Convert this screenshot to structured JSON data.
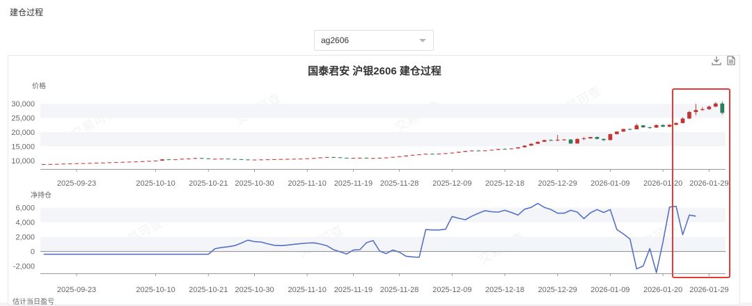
{
  "section_title": "建仓过程",
  "contract_select": {
    "value": "ag2606"
  },
  "chart_title": "国泰君安 沪银2606 建仓过程",
  "toolbar": {
    "download_icon": "download-icon",
    "data_view_icon": "data-view-icon"
  },
  "watermark_text": "交易可查",
  "colors": {
    "up": "#c23531",
    "down": "#2f7e5e",
    "line": "#5470c6",
    "highlight": "#e53935",
    "band": "#f3f5f9"
  },
  "chart_data": [
    {
      "type": "candlestick",
      "ylabel": "价格",
      "y_ticks": [
        "30,000",
        "25,000",
        "20,000",
        "15,000",
        "10,000"
      ],
      "y_tick_values": [
        30000,
        25000,
        20000,
        15000,
        10000
      ],
      "ylim": [
        7000,
        33000
      ],
      "x_tick_labels": [
        "2025-09-23",
        "2025-10-10",
        "2025-10-21",
        "2025-10-30",
        "2025-11-10",
        "2025-11-19",
        "2025-11-28",
        "2025-12-09",
        "2025-12-18",
        "2025-12-29",
        "2026-01-09",
        "2026-01-20",
        "2026-01-29"
      ],
      "x_tick_index": [
        5,
        17,
        25,
        32,
        40,
        47,
        54,
        62,
        70,
        78,
        86,
        94,
        101
      ],
      "n": 104,
      "ohlc": [
        [
          8700,
          8750,
          8650,
          8720
        ],
        [
          8720,
          8780,
          8680,
          8760
        ],
        [
          8760,
          8820,
          8700,
          8790
        ],
        [
          8790,
          8900,
          8750,
          8880
        ],
        [
          8880,
          8950,
          8820,
          8930
        ],
        [
          8930,
          9050,
          8900,
          9020
        ],
        [
          9020,
          9100,
          8980,
          9060
        ],
        [
          9060,
          9150,
          9000,
          9120
        ],
        [
          9120,
          9250,
          9080,
          9200
        ],
        [
          9200,
          9300,
          9150,
          9260
        ],
        [
          9260,
          9400,
          9220,
          9350
        ],
        [
          9350,
          9450,
          9300,
          9420
        ],
        [
          9420,
          9550,
          9380,
          9500
        ],
        [
          9500,
          9620,
          9450,
          9580
        ],
        [
          9580,
          9700,
          9520,
          9650
        ],
        [
          9650,
          9800,
          9600,
          9750
        ],
        [
          9750,
          9900,
          9700,
          9850
        ],
        [
          9850,
          10000,
          9800,
          9950
        ],
        [
          9950,
          10500,
          9900,
          10400
        ],
        [
          10400,
          10500,
          10200,
          10250
        ],
        [
          10250,
          10450,
          10200,
          10400
        ],
        [
          10400,
          10700,
          10350,
          10600
        ],
        [
          10600,
          10800,
          10500,
          10700
        ],
        [
          10700,
          10900,
          10600,
          10850
        ],
        [
          10850,
          11000,
          10700,
          10750
        ],
        [
          10750,
          10800,
          10500,
          10550
        ],
        [
          10550,
          10650,
          10450,
          10600
        ],
        [
          10600,
          10700,
          10500,
          10650
        ],
        [
          10650,
          10700,
          10500,
          10520
        ],
        [
          10520,
          10600,
          10400,
          10450
        ],
        [
          10450,
          10500,
          10300,
          10350
        ],
        [
          10350,
          10400,
          10200,
          10250
        ],
        [
          10250,
          10350,
          10150,
          10300
        ],
        [
          10300,
          10400,
          10200,
          10350
        ],
        [
          10350,
          10450,
          10250,
          10400
        ],
        [
          10400,
          10500,
          10300,
          10450
        ],
        [
          10450,
          10550,
          10350,
          10500
        ],
        [
          10500,
          10600,
          10400,
          10550
        ],
        [
          10550,
          10650,
          10450,
          10600
        ],
        [
          10600,
          10700,
          10500,
          10650
        ],
        [
          10650,
          10800,
          10600,
          10750
        ],
        [
          10750,
          10900,
          10700,
          10850
        ],
        [
          10850,
          11100,
          10800,
          11050
        ],
        [
          11050,
          11250,
          11000,
          11200
        ],
        [
          11200,
          11300,
          11050,
          11100
        ],
        [
          11100,
          11150,
          10900,
          10950
        ],
        [
          10950,
          11000,
          10800,
          10850
        ],
        [
          10850,
          10950,
          10750,
          10900
        ],
        [
          10900,
          11000,
          10800,
          10950
        ],
        [
          10950,
          11050,
          10850,
          10800
        ],
        [
          10800,
          10900,
          10700,
          10850
        ],
        [
          10850,
          11000,
          10800,
          10950
        ],
        [
          10950,
          11100,
          10900,
          11050
        ],
        [
          11050,
          11300,
          11000,
          11250
        ],
        [
          11250,
          11500,
          11200,
          11450
        ],
        [
          11450,
          11800,
          11400,
          11750
        ],
        [
          11750,
          12000,
          11700,
          11950
        ],
        [
          11950,
          12200,
          11900,
          12150
        ],
        [
          12150,
          12400,
          12100,
          12350
        ],
        [
          12350,
          12500,
          12200,
          12300
        ],
        [
          12300,
          12450,
          12200,
          12400
        ],
        [
          12400,
          12600,
          12350,
          12550
        ],
        [
          12550,
          12800,
          12500,
          12750
        ],
        [
          12750,
          13100,
          12700,
          13050
        ],
        [
          13050,
          13400,
          13000,
          13350
        ],
        [
          13350,
          13600,
          13200,
          13500
        ],
        [
          13500,
          13700,
          13300,
          13400
        ],
        [
          13400,
          13600,
          13300,
          13550
        ],
        [
          13550,
          13800,
          13500,
          13750
        ],
        [
          13750,
          14100,
          13700,
          14050
        ],
        [
          14050,
          14300,
          13900,
          14000
        ],
        [
          14000,
          14300,
          13950,
          14250
        ],
        [
          14250,
          14700,
          14200,
          14650
        ],
        [
          14650,
          15300,
          14600,
          15250
        ],
        [
          15250,
          16000,
          15200,
          15900
        ],
        [
          15900,
          16700,
          15800,
          16600
        ],
        [
          16600,
          17300,
          16500,
          17200
        ],
        [
          17200,
          17500,
          16900,
          17100
        ],
        [
          17100,
          19000,
          16800,
          17300
        ],
        [
          17300,
          17600,
          17000,
          17400
        ],
        [
          17400,
          17500,
          15800,
          16000
        ],
        [
          16000,
          17800,
          15900,
          17600
        ],
        [
          17600,
          18300,
          17200,
          17800
        ],
        [
          17800,
          18200,
          17600,
          18300
        ],
        [
          18300,
          18400,
          17500,
          17600
        ],
        [
          17600,
          17800,
          16800,
          17200
        ],
        [
          17200,
          19400,
          17100,
          19300
        ],
        [
          19300,
          20300,
          19200,
          20200
        ],
        [
          20200,
          21200,
          20100,
          21100
        ],
        [
          21100,
          21300,
          20700,
          21000
        ],
        [
          21000,
          23000,
          21000,
          22400
        ],
        [
          22400,
          22500,
          21500,
          21700
        ],
        [
          21700,
          22000,
          21200,
          21600
        ],
        [
          21600,
          22700,
          21500,
          22500
        ],
        [
          22500,
          22800,
          21800,
          21900
        ],
        [
          21900,
          22700,
          21800,
          22600
        ],
        [
          22600,
          23500,
          22400,
          23200
        ],
        [
          23200,
          25200,
          23100,
          24800
        ],
        [
          24800,
          27500,
          24600,
          27100
        ],
        [
          27100,
          30000,
          26000,
          27800
        ],
        [
          27800,
          28800,
          27500,
          28100
        ],
        [
          28100,
          29400,
          27900,
          29000
        ],
        [
          29000,
          30600,
          28800,
          30100
        ],
        [
          30100,
          30800,
          26200,
          26800
        ]
      ]
    },
    {
      "type": "line",
      "ylabel": "净持仓",
      "y_ticks": [
        "6,000",
        "4,000",
        "2,000",
        "0",
        "-2,000"
      ],
      "y_tick_values": [
        6000,
        4000,
        2000,
        0,
        -2000
      ],
      "ylim": [
        -3000,
        7500
      ],
      "x_tick_labels": [
        "2025-09-23",
        "2025-10-10",
        "2025-10-21",
        "2025-10-30",
        "2025-11-10",
        "2025-11-19",
        "2025-11-28",
        "2025-12-09",
        "2025-12-18",
        "2025-12-29",
        "2026-01-09",
        "2026-01-20",
        "2026-01-29"
      ],
      "x_tick_index": [
        5,
        17,
        25,
        32,
        40,
        47,
        54,
        62,
        70,
        78,
        86,
        94,
        101
      ],
      "n": 104,
      "points": [
        [
          0,
          -380
        ],
        [
          22,
          -380
        ],
        [
          23,
          -380
        ],
        [
          24,
          -380
        ],
        [
          25,
          -380
        ],
        [
          26,
          380
        ],
        [
          27,
          550
        ],
        [
          28,
          650
        ],
        [
          29,
          800
        ],
        [
          30,
          1150
        ],
        [
          31,
          1550
        ],
        [
          32,
          1350
        ],
        [
          33,
          1300
        ],
        [
          34,
          1050
        ],
        [
          35,
          850
        ],
        [
          36,
          800
        ],
        [
          37,
          880
        ],
        [
          38,
          980
        ],
        [
          39,
          1080
        ],
        [
          40,
          1150
        ],
        [
          41,
          1180
        ],
        [
          42,
          1020
        ],
        [
          43,
          780
        ],
        [
          44,
          250
        ],
        [
          45,
          -50
        ],
        [
          46,
          -350
        ],
        [
          47,
          200
        ],
        [
          48,
          250
        ],
        [
          49,
          1200
        ],
        [
          50,
          1500
        ],
        [
          51,
          50
        ],
        [
          52,
          -300
        ],
        [
          53,
          200
        ],
        [
          54,
          -100
        ],
        [
          55,
          -650
        ],
        [
          56,
          -750
        ],
        [
          57,
          -800
        ],
        [
          58,
          3000
        ],
        [
          59,
          2950
        ],
        [
          60,
          2950
        ],
        [
          61,
          3050
        ],
        [
          62,
          4800
        ],
        [
          63,
          4550
        ],
        [
          64,
          4350
        ],
        [
          65,
          4850
        ],
        [
          66,
          5250
        ],
        [
          67,
          5600
        ],
        [
          68,
          5450
        ],
        [
          69,
          5400
        ],
        [
          70,
          5650
        ],
        [
          71,
          5350
        ],
        [
          72,
          5000
        ],
        [
          73,
          5800
        ],
        [
          74,
          6050
        ],
        [
          75,
          6600
        ],
        [
          76,
          6050
        ],
        [
          77,
          5750
        ],
        [
          78,
          5250
        ],
        [
          79,
          5250
        ],
        [
          80,
          5650
        ],
        [
          81,
          5400
        ],
        [
          82,
          4500
        ],
        [
          83,
          5300
        ],
        [
          84,
          5750
        ],
        [
          85,
          5350
        ],
        [
          86,
          5750
        ],
        [
          87,
          3000
        ],
        [
          88,
          2400
        ],
        [
          89,
          1700
        ],
        [
          90,
          -2400
        ],
        [
          91,
          -2000
        ],
        [
          92,
          400
        ],
        [
          93,
          -2900
        ],
        [
          94,
          1300
        ],
        [
          95,
          6100
        ],
        [
          96,
          6200
        ],
        [
          97,
          2300
        ],
        [
          98,
          5000
        ],
        [
          99,
          4850
        ]
      ]
    }
  ],
  "bottom_label": "估计当日盈亏"
}
